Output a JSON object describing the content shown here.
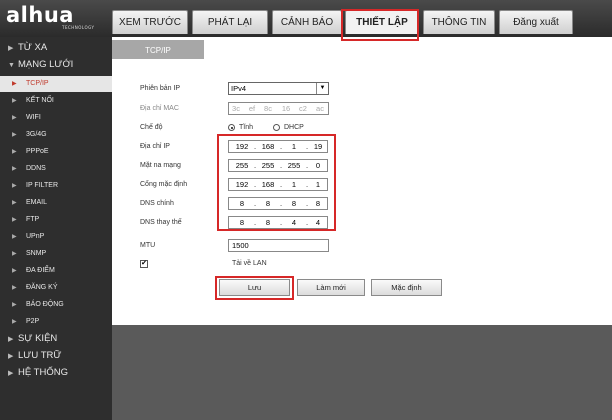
{
  "brand": {
    "logo": "alhua",
    "tagline": "TECHNOLOGY"
  },
  "tabs": [
    {
      "label": "XEM TRƯỚC"
    },
    {
      "label": "PHÁT LẠI"
    },
    {
      "label": "CẢNH BÁO"
    },
    {
      "label": "THIẾT LẬP",
      "active": true
    },
    {
      "label": "THÔNG TIN"
    },
    {
      "label": "Đăng xuất"
    }
  ],
  "sidebar": {
    "items": [
      {
        "label": "TỪ XA",
        "level": "top",
        "arrow": "▶"
      },
      {
        "label": "MẠNG LƯỚI",
        "level": "top",
        "arrow": "▼"
      },
      {
        "label": "TCP/IP",
        "level": "sub",
        "selected": true,
        "arrow": "▶"
      },
      {
        "label": "KẾT NỐI",
        "level": "sub",
        "arrow": "▶"
      },
      {
        "label": "WIFI",
        "level": "sub",
        "arrow": "▶"
      },
      {
        "label": "3G/4G",
        "level": "sub",
        "arrow": "▶"
      },
      {
        "label": "PPPoE",
        "level": "sub",
        "arrow": "▶"
      },
      {
        "label": "DDNS",
        "level": "sub",
        "arrow": "▶"
      },
      {
        "label": "IP FILTER",
        "level": "sub",
        "arrow": "▶"
      },
      {
        "label": "EMAIL",
        "level": "sub",
        "arrow": "▶"
      },
      {
        "label": "FTP",
        "level": "sub",
        "arrow": "▶"
      },
      {
        "label": "UPnP",
        "level": "sub",
        "arrow": "▶"
      },
      {
        "label": "SNMP",
        "level": "sub",
        "arrow": "▶"
      },
      {
        "label": "ĐA ĐIỂM",
        "level": "sub",
        "arrow": "▶"
      },
      {
        "label": "ĐĂNG KÝ",
        "level": "sub",
        "arrow": "▶"
      },
      {
        "label": "BÁO ĐỘNG",
        "level": "sub",
        "arrow": "▶"
      },
      {
        "label": "P2P",
        "level": "sub",
        "arrow": "▶"
      },
      {
        "label": "SỰ KIỆN",
        "level": "top",
        "arrow": "▶"
      },
      {
        "label": "LƯU TRỮ",
        "level": "top",
        "arrow": "▶"
      },
      {
        "label": "HỆ THỐNG",
        "level": "top",
        "arrow": "▶"
      }
    ]
  },
  "page": {
    "tab_title": "TCP/IP"
  },
  "form": {
    "ip_version": {
      "label": "Phiên bản IP",
      "value": "IPv4",
      "chevron": "▼"
    },
    "mac": {
      "label": "Địa chỉ MAC",
      "octets": [
        "3c",
        "ef",
        "8c",
        "16",
        "c2",
        "ac"
      ]
    },
    "mode": {
      "label": "Chế độ",
      "options": [
        "Tĩnh",
        "DHCP"
      ],
      "selected": "Tĩnh"
    },
    "ip_address": {
      "label": "Địa chỉ IP",
      "octets": [
        "192",
        "168",
        "1",
        "19"
      ]
    },
    "subnet": {
      "label": "Mặt na mạng",
      "octets": [
        "255",
        "255",
        "255",
        "0"
      ]
    },
    "gateway": {
      "label": "Cổng mặc định",
      "octets": [
        "192",
        "168",
        "1",
        "1"
      ]
    },
    "dns_primary": {
      "label": "DNS chính",
      "octets": [
        "8",
        "8",
        "8",
        "8"
      ]
    },
    "dns_secondary": {
      "label": "DNS thay thế",
      "octets": [
        "8",
        "8",
        "4",
        "4"
      ]
    },
    "mtu": {
      "label": "MTU",
      "value": "1500"
    },
    "lan_download": {
      "label": "Tải về LAN",
      "checked": true,
      "mark": "✔"
    }
  },
  "buttons": {
    "save": "Lưu",
    "refresh": "Làm mới",
    "default": "Mặc định"
  },
  "colors": {
    "highlight": "#d62828",
    "topbar": "#3a3a3a",
    "sidebar": "#2e2e2e",
    "selected_text": "#c0392b"
  }
}
